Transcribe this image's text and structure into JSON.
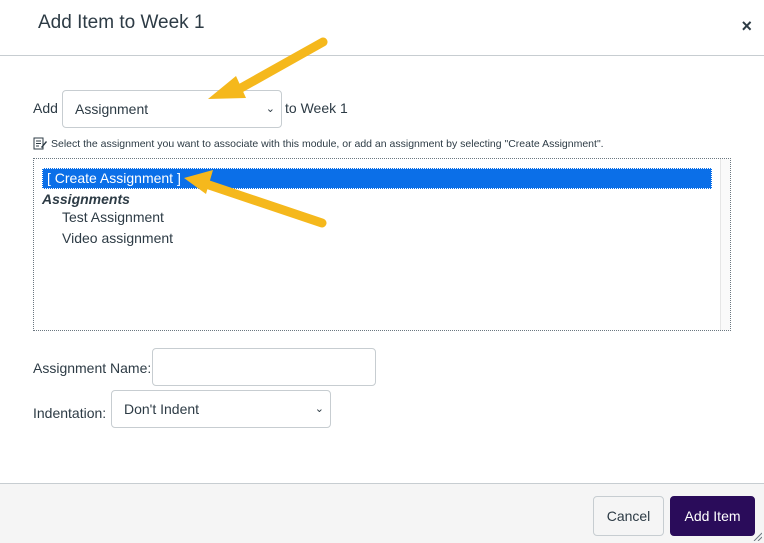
{
  "dialog": {
    "title": "Add Item to Week 1",
    "close_glyph": "×"
  },
  "add_row": {
    "prefix": "Add",
    "type_selected": "Assignment",
    "suffix": "to Week 1"
  },
  "hint": {
    "text": "Select the assignment you want to associate with this module, or add an assignment by selecting \"Create Assignment\"."
  },
  "listbox": {
    "create_option": "[ Create Assignment ]",
    "group_label": "Assignments",
    "items": [
      "Test Assignment",
      "Video assignment"
    ]
  },
  "form": {
    "name_label": "Assignment Name:",
    "name_value": "",
    "indent_label": "Indentation:",
    "indent_selected": "Don't Indent"
  },
  "footer": {
    "cancel_label": "Cancel",
    "add_label": "Add Item"
  },
  "colors": {
    "selected_bg": "#0b6fe8",
    "primary_button": "#2a0c5a",
    "annotation_arrow": "#f5b81c"
  }
}
